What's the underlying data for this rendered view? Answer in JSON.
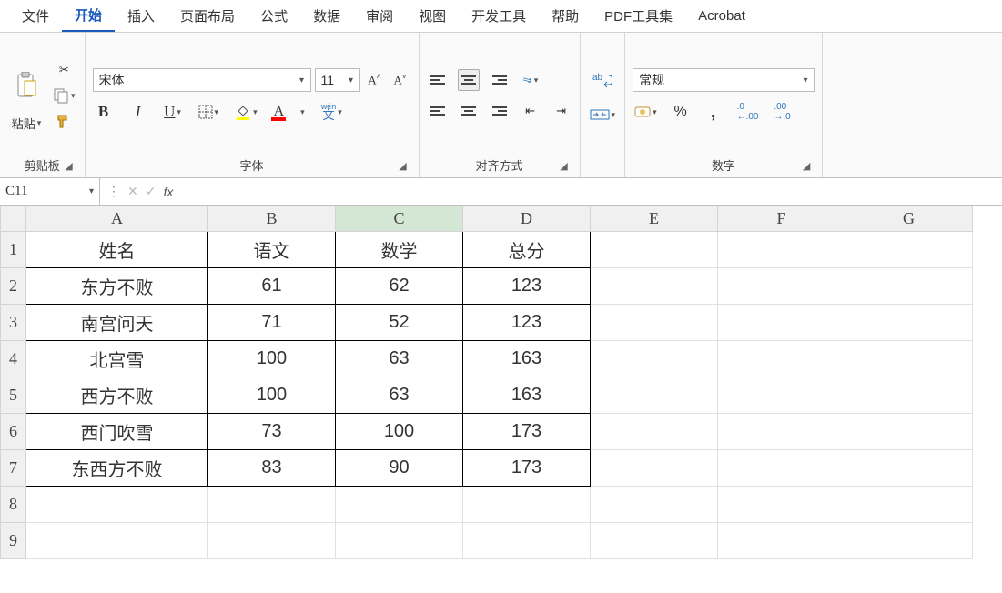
{
  "menu": {
    "items": [
      "文件",
      "开始",
      "插入",
      "页面布局",
      "公式",
      "数据",
      "审阅",
      "视图",
      "开发工具",
      "帮助",
      "PDF工具集",
      "Acrobat"
    ],
    "active_index": 1
  },
  "ribbon": {
    "clipboard": {
      "paste": "粘贴",
      "group_label": "剪贴板"
    },
    "font": {
      "name": "宋体",
      "size": "11",
      "group_label": "字体",
      "bold": "B",
      "italic": "I",
      "underline": "U",
      "wen": "wén",
      "wen2": "文"
    },
    "align": {
      "group_label": "对齐方式"
    },
    "number": {
      "format": "常规",
      "group_label": "数字",
      "pct": "%",
      "comma": ",",
      "inc": ".00",
      "dec": ".00"
    }
  },
  "formula_bar": {
    "name_box": "C11",
    "fx": "fx",
    "value": ""
  },
  "chart_data": {
    "type": "table",
    "columns": [
      "A",
      "B",
      "C",
      "D",
      "E",
      "F",
      "G"
    ],
    "selected_col": "C",
    "rows": [
      {
        "n": "1",
        "A": "姓名",
        "B": "语文",
        "C": "数学",
        "D": "总分"
      },
      {
        "n": "2",
        "A": "东方不败",
        "B": "61",
        "C": "62",
        "D": "123"
      },
      {
        "n": "3",
        "A": "南宫问天",
        "B": "71",
        "C": "52",
        "D": "123"
      },
      {
        "n": "4",
        "A": "北宫雪",
        "B": "100",
        "C": "63",
        "D": "163"
      },
      {
        "n": "5",
        "A": "西方不败",
        "B": "100",
        "C": "63",
        "D": "163"
      },
      {
        "n": "6",
        "A": "西门吹雪",
        "B": "73",
        "C": "100",
        "D": "173"
      },
      {
        "n": "7",
        "A": "东西方不败",
        "B": "83",
        "C": "90",
        "D": "173"
      },
      {
        "n": "8"
      },
      {
        "n": "9"
      }
    ],
    "data_col_count": 4
  }
}
